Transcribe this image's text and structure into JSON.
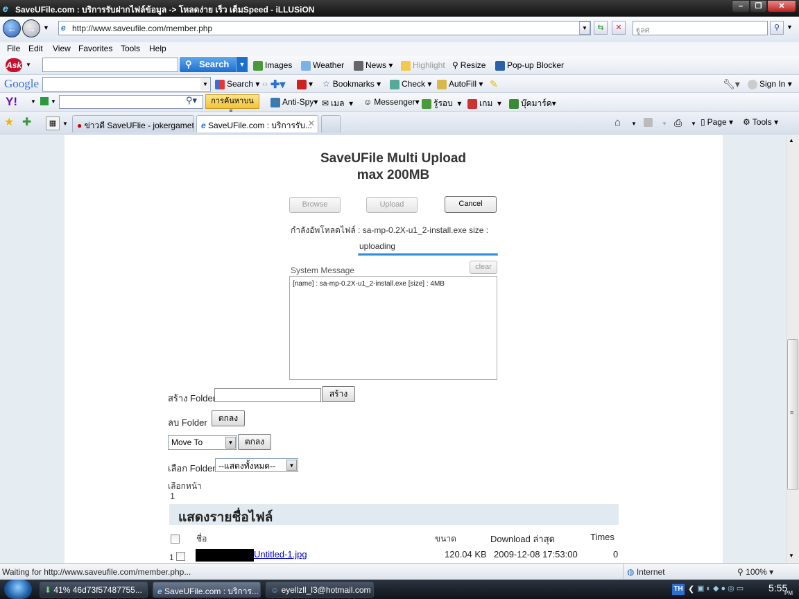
{
  "window": {
    "title": "SaveUFile.com : บริการรับฝากไฟล์ข้อมูล -> โหลดง่าย เร็ว เต็มSpeed - iLLUSiON"
  },
  "address": {
    "url": "http://www.saveufile.com/member.php",
    "search_placeholder": "ฐูลศ"
  },
  "menu": [
    "File",
    "Edit",
    "View",
    "Favorites",
    "Tools",
    "Help"
  ],
  "ask_toolbar": {
    "search_label": "Search",
    "items": [
      "Images",
      "Weather",
      "News",
      "Highlight",
      "Resize",
      "Pop-up Blocker"
    ]
  },
  "google_toolbar": {
    "logo": "Google",
    "search_label": "Search",
    "items": [
      "Bookmarks",
      "Check",
      "AutoFill"
    ],
    "signin": "Sign In"
  },
  "yahoo_toolbar": {
    "logo": "Y!",
    "search_btn": "การค้นหาบนเว็บ",
    "items": [
      "Anti-Spy",
      "เมล",
      "Messenger",
      "รู้รอบ",
      "เกม",
      "บุ๊คมาร์ค"
    ]
  },
  "tabs": [
    {
      "label": "ข่าวดี SaveUFlie - jokergamet..."
    },
    {
      "label": "SaveUFile.com : บริการรับ..."
    }
  ],
  "cmdbar": {
    "page": "Page",
    "tools": "Tools"
  },
  "upload": {
    "title_line1": "SaveUFile Multi Upload",
    "title_line2": "max 200MB",
    "browse": "Browse",
    "upload": "Upload",
    "cancel": "Cancel",
    "status_text": "กำลังอัพโหลดไฟล์ : sa-mp-0.2X-u1_2-install.exe size :",
    "progress_label": "uploading",
    "sysmsg_label": "System Message",
    "clear": "clear",
    "sysmsg_text": "[name] : sa-mp-0.2X-u1_2-install.exe [size] : 4MB"
  },
  "folders": {
    "create_label": "สร้าง Folder",
    "create_btn": "สร้าง",
    "delete_label": "ลบ Folder",
    "ok_btn": "ตกลง",
    "moveto": "Move To",
    "select_label": "เลือก Folder",
    "select_value": "--แสดงทั้งหมด--",
    "page_label": "เลือกหน้า",
    "page_num": "1"
  },
  "files": {
    "heading": "แสดงรายชื่อไฟล์",
    "col_name": "ชื่อ",
    "col_size": "ขนาด",
    "col_last": "Download ล่าสุด",
    "col_times": "Times",
    "rows": [
      {
        "num": "1",
        "name": "Untitled-1.jpg",
        "size": "120.04 KB",
        "last": "2009-12-08 17:53:00",
        "times": "0"
      }
    ]
  },
  "status": {
    "text": "Waiting for http://www.saveufile.com/member.php...",
    "zone": "Internet",
    "zoom": "100%"
  },
  "taskbar": {
    "tasks": [
      "41% 46d73f57487755...",
      "SaveUFile.com : บริการ...",
      "eyellzll_l3@hotmail.com"
    ],
    "lang": "TH",
    "time": "5:55",
    "ampm": "PM"
  },
  "colors": {
    "link": "#0000cc",
    "band": "#e5ecf2",
    "progress": "#2a8ed8"
  }
}
